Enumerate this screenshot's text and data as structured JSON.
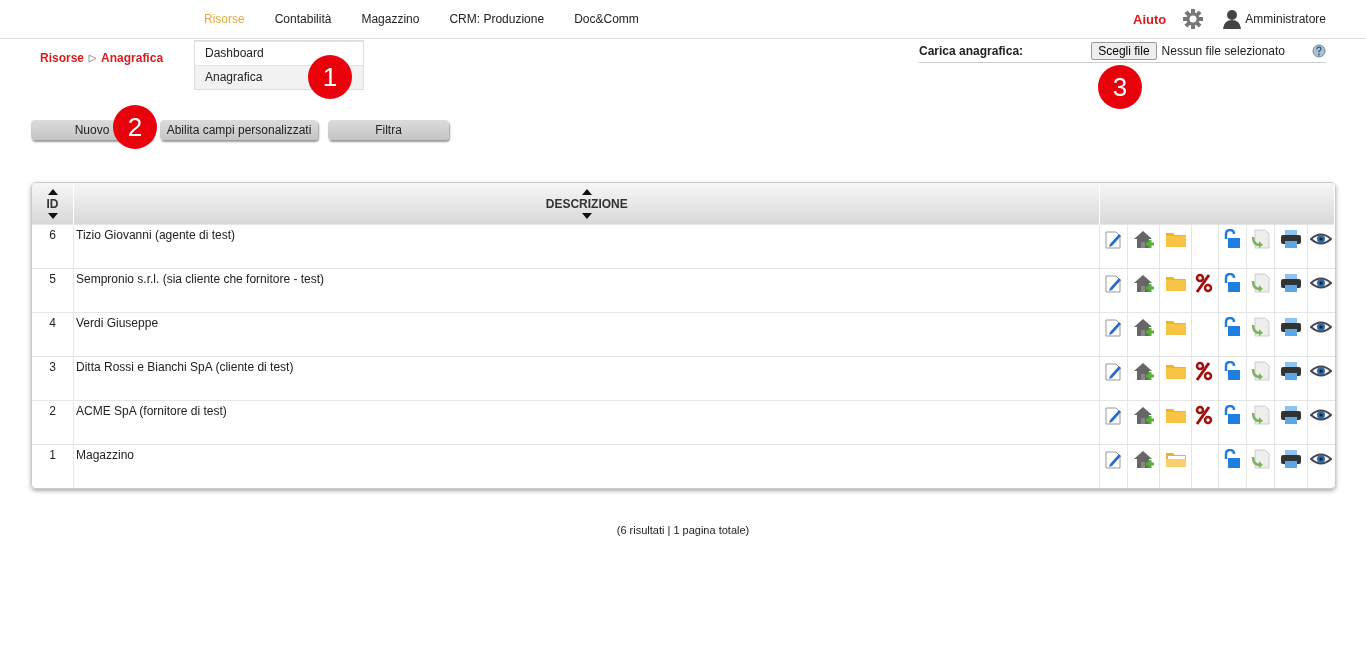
{
  "nav": {
    "items": [
      {
        "label": "Risorse",
        "selected": true
      },
      {
        "label": "Contabilità",
        "selected": false
      },
      {
        "label": "Magazzino",
        "selected": false
      },
      {
        "label": "CRM: Produzione",
        "selected": false
      },
      {
        "label": "Doc&Comm",
        "selected": false
      }
    ],
    "dropdown": [
      {
        "label": "Dashboard",
        "selected": false
      },
      {
        "label": "Anagrafica",
        "selected": true
      }
    ]
  },
  "help": "Aiuto",
  "user": "Amministratore",
  "breadcrumb": [
    "Risorse",
    "Anagrafica"
  ],
  "upload": {
    "label": "Carica anagrafica:",
    "button": "Scegli file",
    "status": "Nessun file selezionato"
  },
  "buttons": [
    "Nuovo",
    "Abilita campi personalizzati",
    "Filtra"
  ],
  "table": {
    "columns": [
      "ID",
      "DESCRIZIONE"
    ],
    "rows": [
      {
        "id": "6",
        "description": "Tizio Giovanni (agente di test)",
        "discount": false,
        "folder_open": false
      },
      {
        "id": "5",
        "description": "Sempronio s.r.l. (sia cliente che fornitore - test)",
        "discount": true,
        "folder_open": false
      },
      {
        "id": "4",
        "description": "Verdi Giuseppe",
        "discount": false,
        "folder_open": false
      },
      {
        "id": "3",
        "description": "Ditta Rossi e Bianchi SpA (cliente di test)",
        "discount": true,
        "folder_open": false
      },
      {
        "id": "2",
        "description": "ACME SpA (fornitore di test)",
        "discount": true,
        "folder_open": false
      },
      {
        "id": "1",
        "description": "Magazzino",
        "discount": false,
        "folder_open": true
      }
    ]
  },
  "footer": "(6 risultati | 1 pagina totale)",
  "callouts": [
    "1",
    "2",
    "3"
  ]
}
